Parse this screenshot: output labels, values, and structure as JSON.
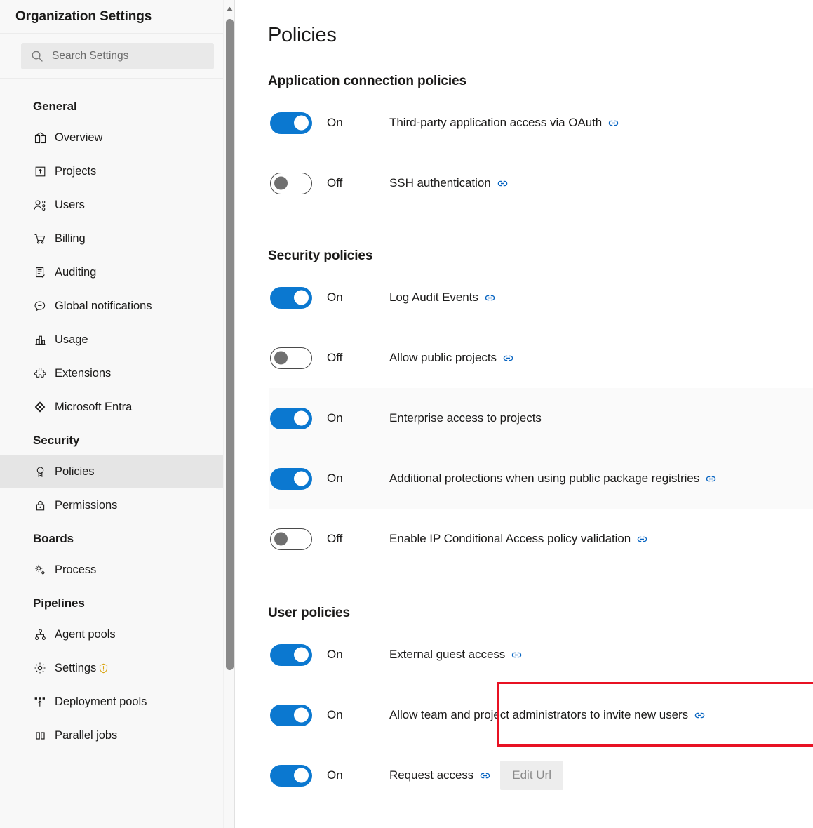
{
  "sidebar": {
    "title": "Organization Settings",
    "search": {
      "placeholder": "Search Settings",
      "value": "",
      "icon": "search-icon"
    },
    "groups": [
      {
        "title": "General",
        "items": [
          {
            "label": "Overview",
            "icon": "overview-icon",
            "selected": false
          },
          {
            "label": "Projects",
            "icon": "projects-icon",
            "selected": false
          },
          {
            "label": "Users",
            "icon": "users-icon",
            "selected": false
          },
          {
            "label": "Billing",
            "icon": "billing-icon",
            "selected": false
          },
          {
            "label": "Auditing",
            "icon": "auditing-icon",
            "selected": false
          },
          {
            "label": "Global notifications",
            "icon": "notification-icon",
            "selected": false
          },
          {
            "label": "Usage",
            "icon": "usage-icon",
            "selected": false
          },
          {
            "label": "Extensions",
            "icon": "extensions-icon",
            "selected": false
          },
          {
            "label": "Microsoft Entra",
            "icon": "entra-icon",
            "selected": false
          }
        ]
      },
      {
        "title": "Security",
        "items": [
          {
            "label": "Policies",
            "icon": "policies-icon",
            "selected": true
          },
          {
            "label": "Permissions",
            "icon": "lock-icon",
            "selected": false
          }
        ]
      },
      {
        "title": "Boards",
        "items": [
          {
            "label": "Process",
            "icon": "process-icon",
            "selected": false
          }
        ]
      },
      {
        "title": "Pipelines",
        "items": [
          {
            "label": "Agent pools",
            "icon": "agent-pools-icon",
            "selected": false
          },
          {
            "label": "Settings",
            "icon": "gear-icon",
            "selected": false,
            "warning": true
          },
          {
            "label": "Deployment pools",
            "icon": "deployment-pools-icon",
            "selected": false
          },
          {
            "label": "Parallel jobs",
            "icon": "parallel-jobs-icon",
            "selected": false
          }
        ]
      }
    ],
    "scrollbar": {
      "up_arrow_icon": "chevron-up-icon"
    }
  },
  "main": {
    "page_title": "Policies",
    "sections": [
      {
        "id": "application-connection-policies",
        "title": "Application connection policies",
        "policies": [
          {
            "state": "On",
            "on": true,
            "label": "Third-party application access via OAuth",
            "link": true,
            "shaded": false
          },
          {
            "state": "Off",
            "on": false,
            "label": "SSH authentication",
            "link": true,
            "shaded": false
          }
        ]
      },
      {
        "id": "security-policies",
        "title": "Security policies",
        "policies": [
          {
            "state": "On",
            "on": true,
            "label": "Log Audit Events",
            "link": true,
            "shaded": false
          },
          {
            "state": "Off",
            "on": false,
            "label": "Allow public projects",
            "link": true,
            "shaded": false
          },
          {
            "state": "On",
            "on": true,
            "label": "Enterprise access to projects",
            "link": false,
            "shaded": true
          },
          {
            "state": "On",
            "on": true,
            "label": "Additional protections when using public package registries",
            "link": true,
            "shaded": true
          },
          {
            "state": "Off",
            "on": false,
            "label": "Enable IP Conditional Access policy validation",
            "link": true,
            "shaded": false
          }
        ]
      },
      {
        "id": "user-policies",
        "title": "User policies",
        "policies": [
          {
            "state": "On",
            "on": true,
            "label": "External guest access",
            "link": true,
            "shaded": false
          },
          {
            "state": "On",
            "on": true,
            "label": "Allow team and project administrators to invite new users",
            "link": true,
            "shaded": false,
            "highlighted": true
          },
          {
            "state": "On",
            "on": true,
            "label": "Request access",
            "link": true,
            "shaded": false,
            "button": "Edit Url"
          }
        ]
      }
    ]
  },
  "colors": {
    "toggle_on": "#0b78d0",
    "toggle_off_knob": "#707070",
    "link_icon": "#0a66c2",
    "highlight_border": "#e81123",
    "sidebar_bg": "#f8f8f8",
    "sidebar_selected": "#e5e5e5",
    "warning_icon": "#d9a514",
    "row_shaded": "#fafafa"
  }
}
